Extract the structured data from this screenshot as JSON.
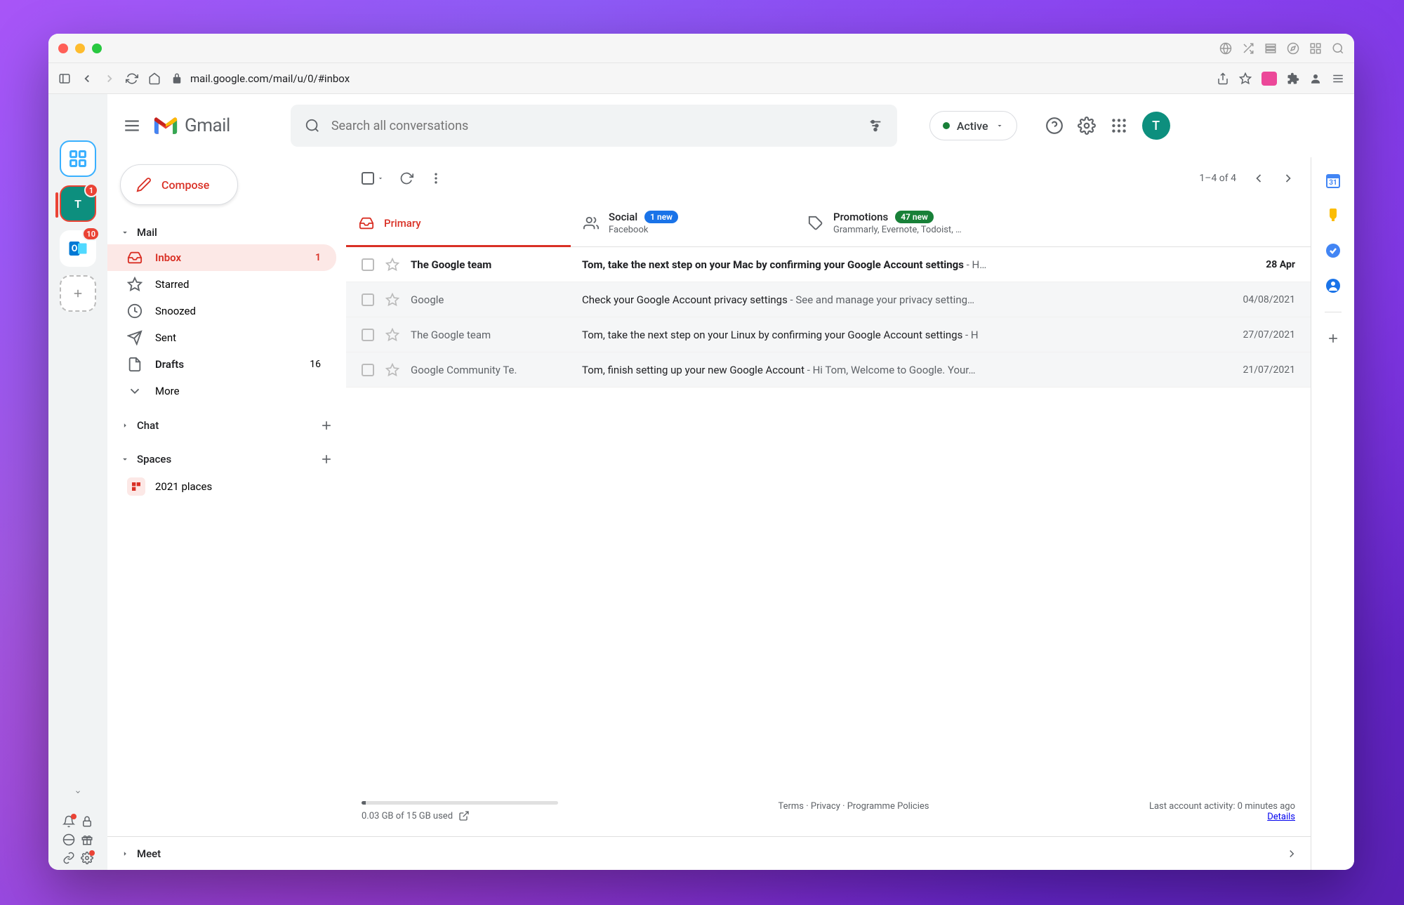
{
  "browser": {
    "url": "mail.google.com/mail/u/0/#inbox"
  },
  "launcher": {
    "teal_badge": "1",
    "outlook_badge": "10",
    "teal_letter": "T"
  },
  "tabstrip": {
    "green_badge": "1",
    "green_letter": "T"
  },
  "header": {
    "logo_text": "Gmail",
    "search_placeholder": "Search all conversations",
    "status": "Active",
    "avatar_letter": "T"
  },
  "compose": "Compose",
  "sidebar": {
    "mail": {
      "label": "Mail",
      "items": [
        {
          "label": "Inbox",
          "count": "1"
        },
        {
          "label": "Starred",
          "count": ""
        },
        {
          "label": "Snoozed",
          "count": ""
        },
        {
          "label": "Sent",
          "count": ""
        },
        {
          "label": "Drafts",
          "count": "16"
        },
        {
          "label": "More",
          "count": ""
        }
      ]
    },
    "chat": {
      "label": "Chat"
    },
    "spaces": {
      "label": "Spaces",
      "items": [
        {
          "label": "2021 places"
        }
      ]
    },
    "meet": {
      "label": "Meet"
    }
  },
  "toolbar": {
    "count": "1–4 of 4"
  },
  "tabs": [
    {
      "title": "Primary",
      "badge": "",
      "sub": ""
    },
    {
      "title": "Social",
      "badge": "1 new",
      "sub": "Facebook"
    },
    {
      "title": "Promotions",
      "badge": "47 new",
      "sub": "Grammarly, Evernote, Todoist, …"
    }
  ],
  "emails": [
    {
      "sender": "The Google team",
      "subject": "Tom, take the next step on your Mac by confirming your Google Account settings",
      "preview": " - H…",
      "date": "28 Apr",
      "unread": true
    },
    {
      "sender": "Google",
      "subject": "Check your Google Account privacy settings",
      "preview": " - See and manage your privacy setting…",
      "date": "04/08/2021",
      "unread": false
    },
    {
      "sender": "The Google team",
      "subject": "Tom, take the next step on your Linux by confirming your Google Account settings",
      "preview": " - H",
      "date": "27/07/2021",
      "unread": false
    },
    {
      "sender": "Google Community Te.",
      "subject": "Tom, finish setting up your new Google Account",
      "preview": " - Hi Tom, Welcome to Google. Your…",
      "date": "21/07/2021",
      "unread": false
    }
  ],
  "footer": {
    "storage": "0.03 GB of 15 GB used",
    "terms": "Terms",
    "privacy": "Privacy",
    "policies": "Programme Policies",
    "activity": "Last account activity: 0 minutes ago",
    "details": "Details"
  }
}
